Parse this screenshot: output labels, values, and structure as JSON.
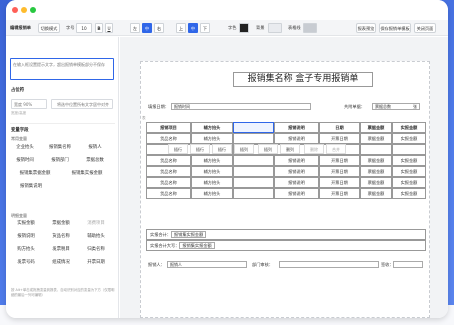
{
  "toolbar": {
    "app_name": "编辑报销单",
    "mode": "切换模式",
    "font_size_label": "字号",
    "font_size": "10",
    "fmt_b": "B",
    "fmt_u": "U",
    "align_l": "左",
    "align_c": "中",
    "align_r": "右",
    "valign_t": "上",
    "valign_m": "中",
    "valign_b": "下",
    "font_color": "字色",
    "bg_color": "背景",
    "border_color": "表格线",
    "preview_btn": "报表预览",
    "save_btn": "保存报销单模板",
    "close_btn": "关闭页面"
  },
  "sidebar": {
    "placeholder_hint": "在输入框设置提示文字，超出报销单模板部分不保存",
    "section_position": "占位符",
    "position_label": "宽度/高度",
    "position_value": "宽度 90%",
    "align_btn": "将选中位置所有文字居中对齐",
    "section_fields": "变量字段",
    "common_vars": "常用变量",
    "common_items": [
      "企业抬头",
      "报销集名称",
      "报销人",
      "报销时间",
      "报销部门",
      "票据总数",
      "报销集票据金额",
      "报销集实报金额",
      "报销集说明"
    ],
    "detail_vars": "明细变量",
    "detail_items": [
      "实报金额",
      "票据金额",
      "消费项目",
      "报销说明",
      "货品名称",
      "辅助抬头",
      "购方抬头",
      "发票税目",
      "归类名称",
      "发票号码",
      "组成情况",
      "开票日期"
    ],
    "footer_note": "按 Alt+单击或拖拽变量到报表，自动识别对应的变量为下方（仅限明细的最后一列可编辑）"
  },
  "doc": {
    "ruler_hint": "页面",
    "title": "报销集名称 盒子专用报销单",
    "fill_date_label": "填报日期：",
    "fill_date_value": "报销时间",
    "total_label": "共附单据：",
    "total_value": "票据总数",
    "total_unit": "张",
    "table_headers": [
      "报销项目",
      "辅方抬头",
      "",
      "报销说明",
      "日期",
      "票据金额",
      "实报金额"
    ],
    "rows": [
      [
        "货品名称",
        "辅方抬头",
        "",
        "报销说明",
        "开票日期",
        "票据金额",
        "实报金额"
      ],
      [
        "货品名称",
        "辅方抬头",
        "",
        "报销说明",
        "开票日期",
        "票据金额",
        "实报金额"
      ],
      [
        "货品名称",
        "辅方抬头",
        "",
        "报销说明",
        "开票日期",
        "票据金额",
        "实报金额"
      ],
      [
        "货品名称",
        "辅方抬头",
        "",
        "报销说明",
        "开票日期",
        "票据金额",
        "实报金额"
      ],
      [
        "货品名称",
        "辅方抬头",
        "",
        "报销说明",
        "开票日期",
        "票据金额",
        "实报金额"
      ]
    ],
    "context_menu": [
      "插行",
      "插行",
      "插行",
      "插列",
      "插列",
      "删列"
    ],
    "ctx_extra": [
      "删除",
      "合并"
    ],
    "sum_label": "实报合计：",
    "sum_value": "报销集实报金额",
    "sum_cap_label": "实报合计大写：",
    "sum_cap_value": "报销集实报金额",
    "sign_reporter_label": "报销人：",
    "sign_reporter_value": "报销人",
    "sign_manager_label": "部门审核：",
    "sign_cashier_label": "经手人：",
    "sign_approve_label": "签收："
  },
  "colors": {
    "accent": "#2f66e8",
    "background": "#4a75e6",
    "dot_red": "#ff5f57",
    "dot_yellow": "#febc2e",
    "dot_green": "#28c840"
  }
}
